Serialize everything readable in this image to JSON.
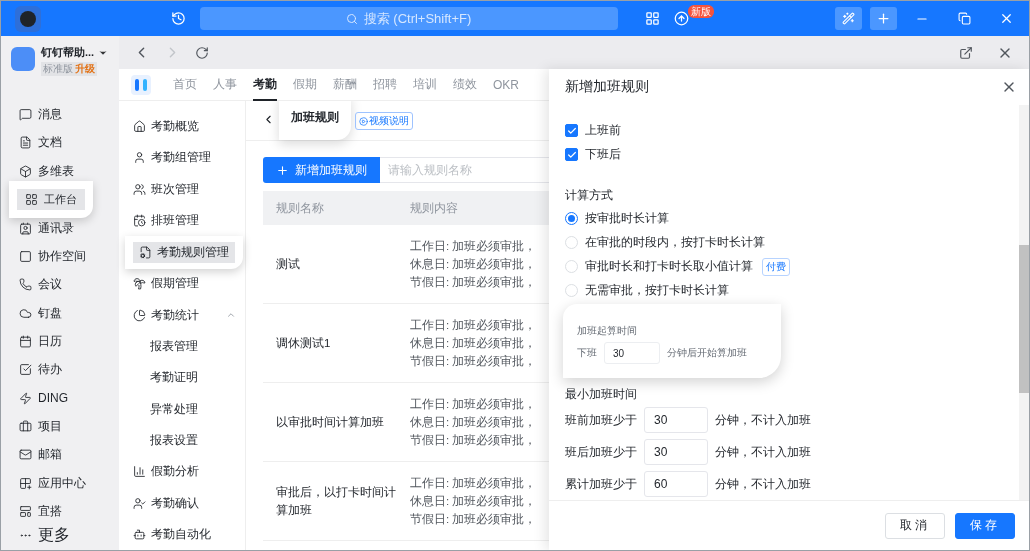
{
  "topbar": {
    "search_placeholder": "搜索 (Ctrl+Shift+F)",
    "badge": "新版"
  },
  "workspace": {
    "name": "钉钉帮助...",
    "edition": "标准版",
    "upgrade": "升级"
  },
  "sidebar": {
    "items": [
      {
        "label": "消息",
        "selected": false
      },
      {
        "label": "文档",
        "selected": false
      },
      {
        "label": "多维表",
        "selected": false
      },
      {
        "label": "工作台",
        "selected": true
      },
      {
        "label": "通讯录",
        "selected": false
      },
      {
        "label": "协作空间",
        "selected": false
      },
      {
        "label": "会议",
        "selected": false
      },
      {
        "label": "钉盘",
        "selected": false
      },
      {
        "label": "日历",
        "selected": false
      },
      {
        "label": "待办",
        "selected": false
      },
      {
        "label": "DING",
        "selected": false
      },
      {
        "label": "项目",
        "selected": false
      },
      {
        "label": "邮箱",
        "selected": false
      },
      {
        "label": "应用中心",
        "selected": false
      },
      {
        "label": "宜搭",
        "selected": false
      }
    ],
    "more": "更多"
  },
  "app_tabs": [
    {
      "label": "首页",
      "selected": false
    },
    {
      "label": "人事",
      "selected": false
    },
    {
      "label": "考勤",
      "selected": true
    },
    {
      "label": "假期",
      "selected": false
    },
    {
      "label": "薪酬",
      "selected": false
    },
    {
      "label": "招聘",
      "selected": false
    },
    {
      "label": "培训",
      "selected": false
    },
    {
      "label": "绩效",
      "selected": false
    },
    {
      "label": "OKR",
      "selected": false
    }
  ],
  "submenu": [
    {
      "label": "考勤概览",
      "selected": false
    },
    {
      "label": "考勤组管理",
      "selected": false
    },
    {
      "label": "班次管理",
      "selected": false
    },
    {
      "label": "排班管理",
      "selected": false
    },
    {
      "label": "考勤规则管理",
      "selected": true
    },
    {
      "label": "假期管理",
      "selected": false
    },
    {
      "label": "考勤统计",
      "selected": false,
      "expanded": true,
      "children": [
        {
          "label": "报表管理",
          "selected": false
        },
        {
          "label": "考勤证明",
          "selected": false
        },
        {
          "label": "异常处理",
          "selected": false
        },
        {
          "label": "报表设置",
          "selected": false
        }
      ]
    },
    {
      "label": "假勤分析",
      "selected": false
    },
    {
      "label": "考勤确认",
      "selected": false
    },
    {
      "label": "考勤自动化",
      "selected": false
    }
  ],
  "page": {
    "title": "加班规则",
    "video_link": "视频说明",
    "add_button": "新增加班规则",
    "search_placeholder": "请输入规则名称",
    "columns": [
      "规则名称",
      "规则内容"
    ],
    "rows": [
      {
        "name": "测试",
        "content": [
          "工作日: 加班必须审批，",
          "休息日: 加班必须审批，",
          "节假日: 加班必须审批，"
        ]
      },
      {
        "name": "调休测试1",
        "content": [
          "工作日: 加班必须审批，",
          "休息日: 加班必须审批，",
          "节假日: 加班必须审批，"
        ]
      },
      {
        "name": "以审批时间计算加班",
        "content": [
          "工作日: 加班必须审批，",
          "休息日: 加班必须审批，",
          "节假日: 加班必须审批，"
        ]
      },
      {
        "name": "审批后，以打卡时间计算加班",
        "content": [
          "工作日: 加班必须审批，",
          "休息日: 加班必须审批，",
          "节假日: 加班必须审批，"
        ]
      }
    ]
  },
  "drawer": {
    "title": "新增加班规则",
    "allow_items": [
      {
        "label": "上班前",
        "checked": true
      },
      {
        "label": "下班后",
        "checked": true
      }
    ],
    "calc_label": "计算方式",
    "calc_options": [
      {
        "label": "按审批时长计算",
        "selected": true
      },
      {
        "label": "在审批的时段内，按打卡时长计算",
        "selected": false
      },
      {
        "label": "审批时长和打卡时长取小值计算",
        "selected": false,
        "tag": "付费"
      },
      {
        "label": "无需审批，按打卡时长计算",
        "selected": false
      }
    ],
    "start": {
      "label": "加班起算时间",
      "prefix": "下班",
      "value": "30",
      "suffix": "分钟后开始算加班"
    },
    "min_label": "最小加班时间",
    "min_rows": [
      {
        "label": "班前加班少于",
        "value": "30",
        "suffix": "分钟，不计入加班"
      },
      {
        "label": "班后加班少于",
        "value": "30",
        "suffix": "分钟，不计入加班"
      },
      {
        "label": "累计加班少于",
        "value": "60",
        "suffix": "分钟，不计入加班"
      }
    ],
    "cancel": "取消",
    "save": "保存"
  }
}
